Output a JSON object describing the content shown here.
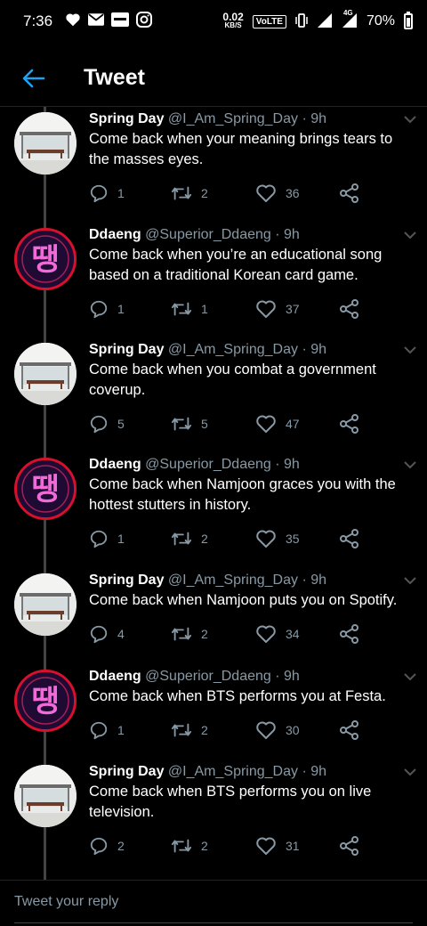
{
  "status_bar": {
    "time": "7:36",
    "net_speed": "0.02",
    "net_unit": "KB/S",
    "volte": "VoLTE",
    "network": "4G",
    "battery": "70%"
  },
  "header": {
    "title": "Tweet"
  },
  "colors": {
    "accent": "#1da1f2",
    "muted": "#8899a6",
    "background": "#000000"
  },
  "tweets": [
    {
      "name": "Spring Day",
      "handle": "@I_Am_Spring_Day",
      "time": "· 9h",
      "text": "Come back when your meaning brings tears to the masses eyes.",
      "replies": "1",
      "retweets": "2",
      "likes": "36",
      "avatar": "bus-stop"
    },
    {
      "name": "Ddaeng",
      "handle": "@Superior_Ddaeng",
      "time": "· 9h",
      "text": "Come back when you’re an educational song based on a traditional Korean card game.",
      "replies": "1",
      "retweets": "1",
      "likes": "37",
      "avatar": "neon-ddaeng"
    },
    {
      "name": "Spring Day",
      "handle": "@I_Am_Spring_Day",
      "time": "· 9h",
      "text": "Come back when you combat a government coverup.",
      "replies": "5",
      "retweets": "5",
      "likes": "47",
      "avatar": "bus-stop"
    },
    {
      "name": "Ddaeng",
      "handle": "@Superior_Ddaeng",
      "time": "· 9h",
      "text": "Come back when Namjoon graces you with the hottest stutters in history.",
      "replies": "1",
      "retweets": "2",
      "likes": "35",
      "avatar": "neon-ddaeng"
    },
    {
      "name": "Spring Day",
      "handle": "@I_Am_Spring_Day",
      "time": "· 9h",
      "text": "Come back when Namjoon puts you on Spotify.",
      "replies": "4",
      "retweets": "2",
      "likes": "34",
      "avatar": "bus-stop"
    },
    {
      "name": "Ddaeng",
      "handle": "@Superior_Ddaeng",
      "time": "· 9h",
      "text": "Come back when BTS performs you at Festa.",
      "replies": "1",
      "retweets": "2",
      "likes": "30",
      "avatar": "neon-ddaeng"
    },
    {
      "name": "Spring Day",
      "handle": "@I_Am_Spring_Day",
      "time": "· 9h",
      "text": "Come back when BTS performs you on live television.",
      "replies": "2",
      "retweets": "2",
      "likes": "31",
      "avatar": "bus-stop"
    }
  ],
  "reply": {
    "placeholder": "Tweet your reply"
  }
}
